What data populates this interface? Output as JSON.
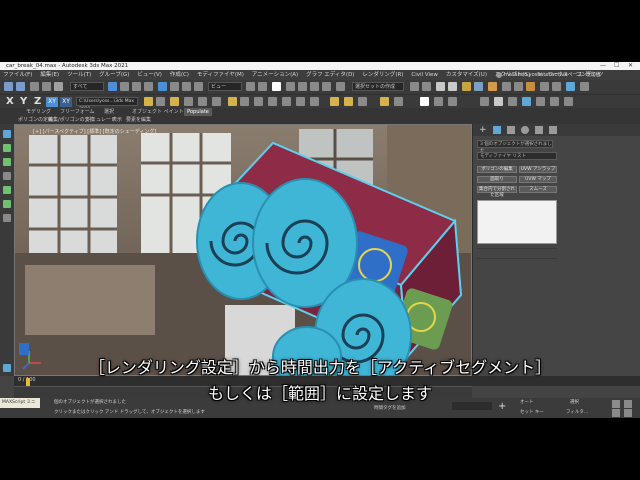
{
  "window": {
    "title": "car_break_04.max - Autodesk 3ds Max 2021",
    "controls": [
      "—",
      "☐",
      "✕"
    ]
  },
  "menu": {
    "items": [
      "ファイル(F)",
      "編集(E)",
      "ツール(T)",
      "グループ(G)",
      "ビュー(V)",
      "作成(C)",
      "モディファイヤ(M)",
      "アニメーション(A)",
      "グラフ エディタ(D)",
      "レンダリング(R)",
      "Civil View",
      "カスタマイズ(U)",
      "スクリプト(S)",
      "Interactive",
      "コンテンツ"
    ],
    "user": "masahiro.yoshi...",
    "workspace": "ワークスペース: 既定値"
  },
  "toolbar": {
    "axis_x": "X",
    "axis_y": "Y",
    "axis_z": "Z",
    "axis_xy": "XY",
    "axis_xy2": "XY",
    "filter_dropdown": "すべて",
    "view_dropdown": "ビュー",
    "selection_set": "選択セットの作成",
    "project_path": "C:\\Users\\yoss...\\3ds Max 2021"
  },
  "ribbon": {
    "tabs": [
      "モデリング",
      "フリーフォーム",
      "選択",
      "オブジェクト ペイント",
      "Populate"
    ],
    "subtabs": [
      "ポリゴンの定義",
      "編集/ポリゴンの変換",
      "シミュレート",
      "表示",
      "要素を編集"
    ]
  },
  "viewport": {
    "label": "[+] [パースペクティブ] [標準] [既定のシェーディング]"
  },
  "command_panel": {
    "name_field": "3 個のオブジェクトが選択されました",
    "modifier_list": "モディファイヤ リスト",
    "buttons": [
      "ポリゴンの編集",
      "UVW アンラップ",
      "面取り",
      "UVW マップ",
      "集合内で分割された区域",
      "スムーズ"
    ]
  },
  "timeline": {
    "frame": "0 / 100"
  },
  "status": {
    "maxscript": "MAXScript ミニ",
    "line1": "個のオブジェクトが選択されました",
    "line2": "クリックまたはクリック アンド ドラッグして、オブジェクトを選択します",
    "add_time_tag": "時間タグを追加",
    "auto": "オート",
    "set_key": "セット キー",
    "selected": "選択",
    "filters": "フィルタ..."
  },
  "subtitles": {
    "line1": "［レンダリング設定］から時間出力を［アクティブセグメント］",
    "line2": "もしくは［範囲］に設定します"
  },
  "colors": {
    "object_cyan": "#3fb6d6",
    "object_maroon": "#8e2c48",
    "face_blue": "#2f6fc8",
    "face_green": "#6c9c52",
    "ui_dark": "#3a3a3a"
  }
}
